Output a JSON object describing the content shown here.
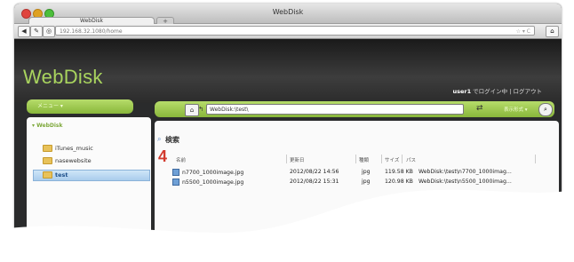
{
  "browser": {
    "window_title": "WebDisk",
    "tab_title": "WebDisk",
    "new_tab": "+",
    "url": "192.168.32.1080/home"
  },
  "header": {
    "logo": "WebDisk",
    "user_name": "user1",
    "login_status": "でログイン中 | ログアウト"
  },
  "sidebar": {
    "menu_label": "メニュー ▾",
    "root": "▾ WebDisk",
    "items": [
      {
        "label": "iTunes_music"
      },
      {
        "label": "nasewebsite"
      },
      {
        "label": "test"
      }
    ]
  },
  "toolbar": {
    "path": "WebDisk:\\test\\",
    "view_mode": "表示形式 ▾"
  },
  "search": {
    "title": "検索",
    "step_number": "4"
  },
  "table": {
    "headers": [
      "名前",
      "更新日",
      "種類",
      "サイズ",
      "パス"
    ],
    "rows": [
      {
        "name": "n7700_1000image.jpg",
        "date": "2012/08/22 14:56",
        "type": "jpg",
        "size": "119.58 KB",
        "path": "WebDisk:\\test\\n7700_1000imag..."
      },
      {
        "name": "n5500_1000image.jpg",
        "date": "2012/08/22 15:31",
        "type": "jpg",
        "size": "120.98 KB",
        "path": "WebDisk:\\test\\n5500_1000imag..."
      }
    ]
  },
  "colors": {
    "accent_green": "#9bc94d",
    "logo_green": "#a9d45e",
    "step_red": "#d23a2e"
  }
}
